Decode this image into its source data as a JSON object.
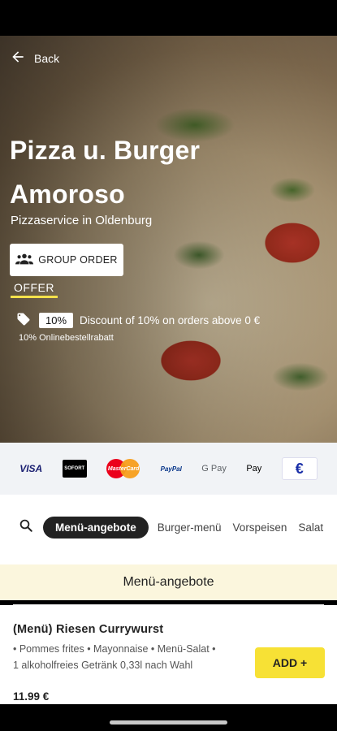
{
  "header": {
    "back_label": "Back"
  },
  "restaurant": {
    "title_line1": "Pizza u. Burger",
    "title_line2": "Amoroso",
    "subtitle": "Pizzaservice in Oldenburg"
  },
  "group_order": {
    "label": "GROUP ORDER"
  },
  "offer": {
    "label": "OFFER",
    "badge": "10%",
    "text": "Discount of 10% on orders above 0 €",
    "note": "10% Onlinebestellrabatt"
  },
  "payments": [
    {
      "name": "visa",
      "label": "VISA"
    },
    {
      "name": "sofort",
      "label": "SOFORT"
    },
    {
      "name": "mastercard",
      "label": "MasterCard"
    },
    {
      "name": "paypal",
      "label": "PayPal"
    },
    {
      "name": "google-pay",
      "label": "G Pay"
    },
    {
      "name": "apple-pay",
      "label": " Pay"
    },
    {
      "name": "euro",
      "label": "€"
    }
  ],
  "categories": {
    "active": "Menü-angebote",
    "items": [
      "Burger-menü",
      "Vorspeisen",
      "Salat"
    ]
  },
  "section": {
    "title": "Menü-angebote"
  },
  "menu_item": {
    "name": "(Menü) Riesen Currywurst",
    "description": "• Pommes frites • Mayonnaise • Menü-Salat • 1 alkoholfreies Getränk 0,33l nach Wahl",
    "price": "11.99 €",
    "add_label": "ADD +"
  },
  "colors": {
    "accent_yellow": "#f7e135",
    "section_bg": "#fbf6dd",
    "payments_bg": "#f1f3f6"
  }
}
